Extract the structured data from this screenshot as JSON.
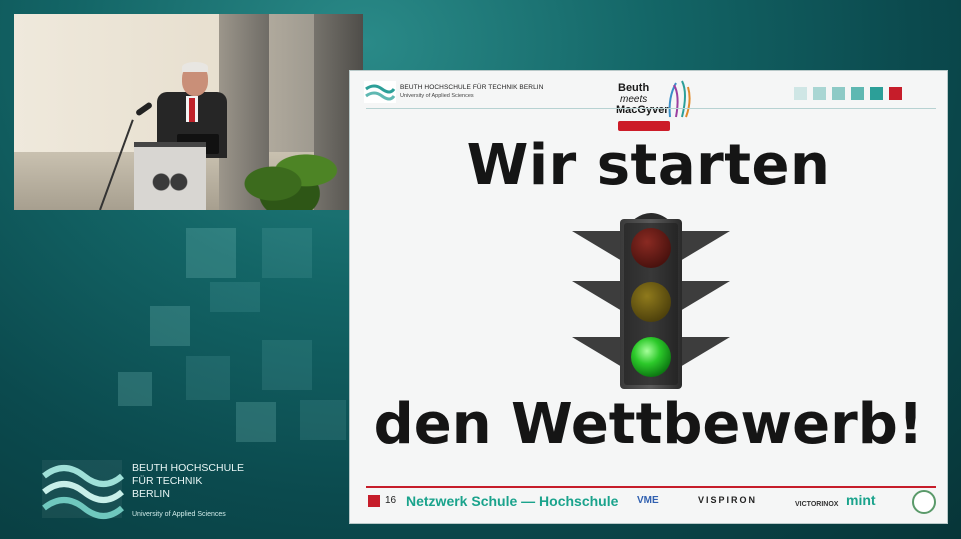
{
  "slide": {
    "header": {
      "institution_line1": "BEUTH HOCHSCHULE FÜR TECHNIK BERLIN",
      "institution_line2": "University of Applied Sciences",
      "brand_line1": "Beuth",
      "brand_line2": "meets",
      "brand_line3": "MacGyver"
    },
    "title_top": "Wir starten",
    "title_bottom": "den Wettbewerb!",
    "traffic_light": {
      "states": [
        "red",
        "yellow",
        "green"
      ],
      "active": "green"
    },
    "footer": {
      "page_number": "16",
      "network_text": "Netzwerk Schule — Hochschule",
      "sponsors": {
        "vme": "VME",
        "vispiron": "VISPIRON",
        "victorinox": "VICTORINOX",
        "mint": "mint"
      }
    },
    "accent_squares": [
      "#cfe6e5",
      "#a9d6d3",
      "#8dcac6",
      "#5fb8b2",
      "#2c9f98",
      "#c61d2a"
    ]
  },
  "branding": {
    "line1": "BEUTH HOCHSCHULE",
    "line2": "FÜR TECHNIK",
    "line3": "BERLIN",
    "line4": "University of Applied Sciences"
  },
  "colors": {
    "background_teal": "#0e4f53",
    "accent_red": "#c61d2a",
    "accent_green": "#1aa38c"
  }
}
